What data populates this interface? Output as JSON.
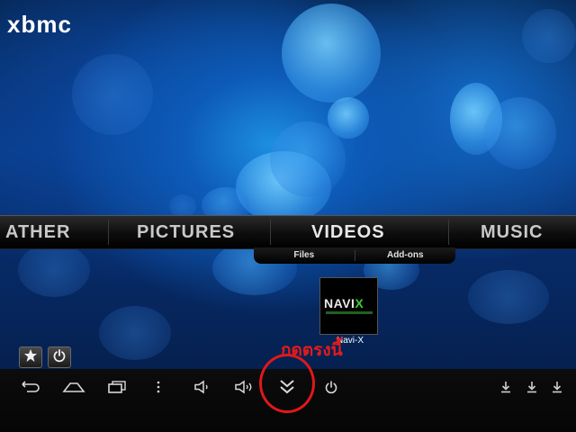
{
  "app": {
    "logo_text": "xbmc"
  },
  "main_menu": {
    "items": [
      {
        "id": "weather",
        "label": "ATHER"
      },
      {
        "id": "pictures",
        "label": "PICTURES"
      },
      {
        "id": "videos",
        "label": "VIDEOS",
        "selected": true
      },
      {
        "id": "music",
        "label": "MUSIC"
      }
    ]
  },
  "submenu": {
    "items": [
      {
        "label": "Files"
      },
      {
        "label": "Add-ons"
      }
    ]
  },
  "addon": {
    "logo_text_main": "NAVI",
    "logo_text_x": "X",
    "label": "Navi-X"
  },
  "annotation": {
    "text": "กดตรงนี้",
    "color": "#e31b1b"
  },
  "corner_buttons": [
    {
      "icon": "star-icon"
    },
    {
      "icon": "power-icon"
    }
  ],
  "android_navbar": {
    "buttons": [
      {
        "icon": "back-icon"
      },
      {
        "icon": "home-icon"
      },
      {
        "icon": "recent-apps-icon"
      },
      {
        "icon": "menu-dots-icon"
      },
      {
        "icon": "volume-down-icon"
      },
      {
        "icon": "volume-up-icon"
      },
      {
        "icon": "double-chevron-down-icon",
        "highlighted": true
      },
      {
        "icon": "power-icon"
      },
      {
        "icon": "download-icon"
      },
      {
        "icon": "download-icon"
      },
      {
        "icon": "download-icon"
      }
    ]
  },
  "colors": {
    "background": "#0a3a86",
    "menu_bar": "#0d0d0d",
    "highlight_circle": "#e01818"
  }
}
